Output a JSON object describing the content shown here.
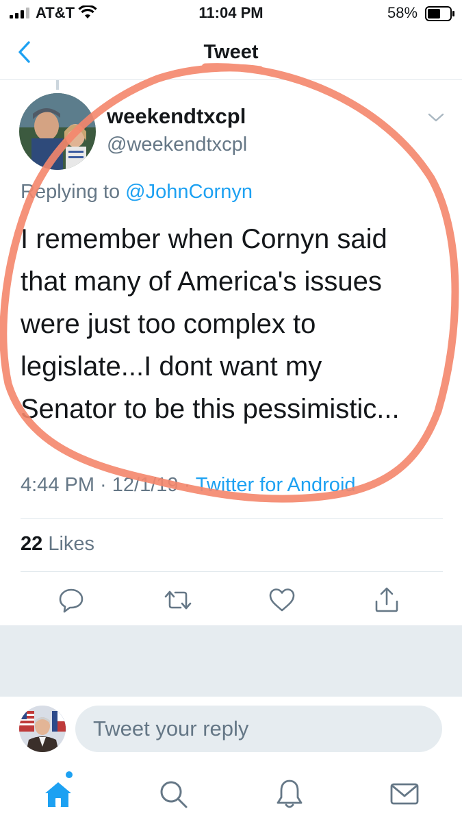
{
  "status_bar": {
    "carrier": "AT&T",
    "time": "11:04 PM",
    "battery_percent": "58%",
    "battery_level": 0.58
  },
  "nav": {
    "title": "Tweet"
  },
  "tweet": {
    "display_name": "weekendtxcpl",
    "handle": "@weekendtxcpl",
    "reply_prefix": "Replying to",
    "reply_mention": "@JohnCornyn",
    "text_lines": [
      "I remember when Cornyn said",
      "that many of America's issues",
      "were just too complex to",
      "legislate...I dont want my",
      "Senator to be this pessimistic..."
    ],
    "time": "4:44 PM",
    "date": "12/1/19",
    "source": "Twitter for Android",
    "likes_count": "22",
    "likes_label": "Likes"
  },
  "actions": [
    "reply-icon",
    "retweet-icon",
    "like-icon",
    "share-icon"
  ],
  "composer": {
    "placeholder": "Tweet your reply"
  },
  "tab_bar": [
    "home-icon",
    "search-icon",
    "notifications-icon",
    "messages-icon"
  ],
  "colors": {
    "accent": "#1da1f2",
    "secondary_text": "#657786",
    "annotation": "#f4866b"
  }
}
